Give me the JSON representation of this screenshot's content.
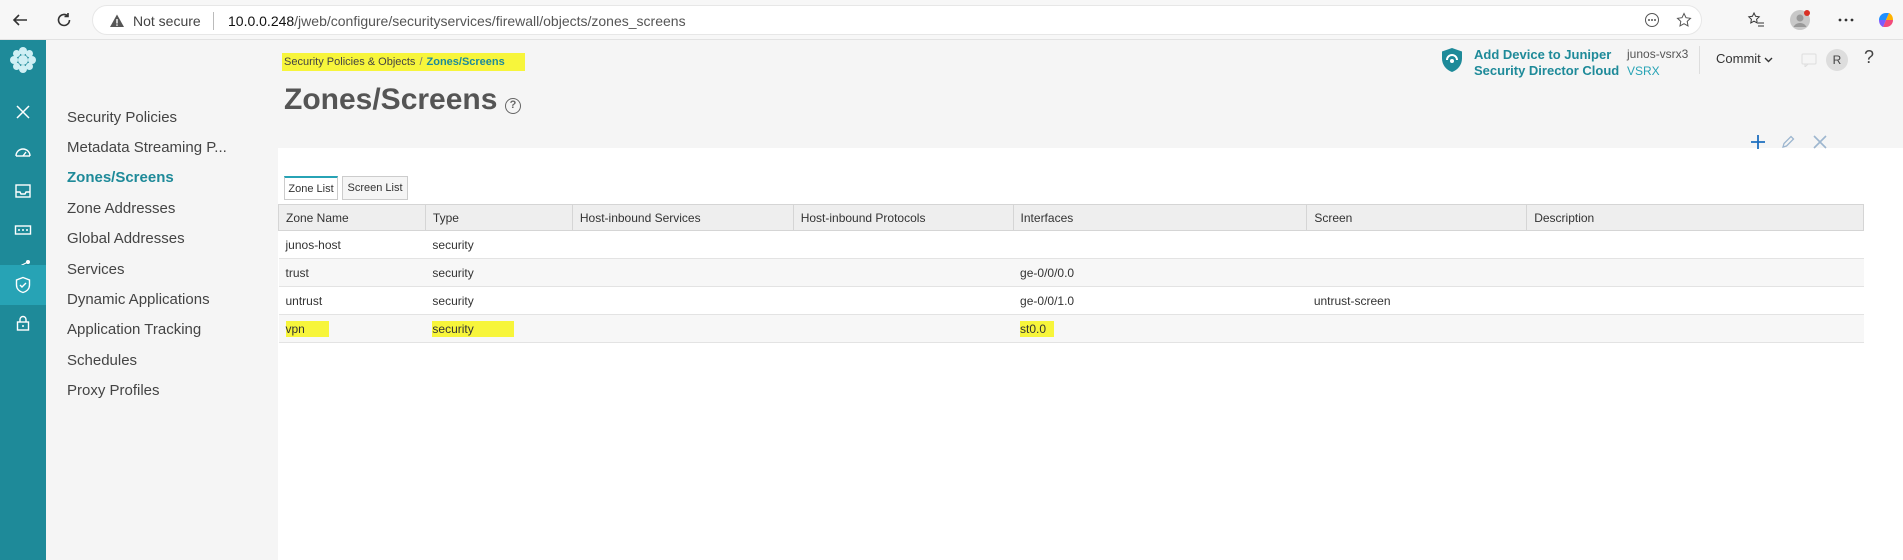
{
  "browser": {
    "not_secure": "Not secure",
    "url_host": "10.0.0.248",
    "url_path": "/jweb/configure/securityservices/firewall/objects/zones_screens"
  },
  "sidenav": {
    "items": [
      {
        "label": "Security Policies"
      },
      {
        "label": "Metadata Streaming P..."
      },
      {
        "label": "Zones/Screens"
      },
      {
        "label": "Zone Addresses"
      },
      {
        "label": "Global Addresses"
      },
      {
        "label": "Services"
      },
      {
        "label": "Dynamic Applications"
      },
      {
        "label": "Application Tracking"
      },
      {
        "label": "Schedules"
      },
      {
        "label": "Proxy Profiles"
      }
    ]
  },
  "breadcrumb": {
    "parent": "Security Policies & Objects",
    "separator": "/",
    "current": "Zones/Screens"
  },
  "page": {
    "title": "Zones/Screens",
    "help": "?"
  },
  "header": {
    "sd_line1": "Add Device to Juniper",
    "sd_line2": "Security Director Cloud",
    "device_name": "junos-vsrx3",
    "device_type": "VSRX",
    "commit": "Commit",
    "avatar": "R",
    "help": "?"
  },
  "tabs": [
    {
      "label": "Zone List"
    },
    {
      "label": "Screen List"
    }
  ],
  "table": {
    "columns": [
      "Zone Name",
      "Type",
      "Host-inbound Services",
      "Host-inbound Protocols",
      "Interfaces",
      "Screen",
      "Description"
    ],
    "rows": [
      [
        "junos-host",
        "security",
        "",
        "",
        "",
        "",
        ""
      ],
      [
        "trust",
        "security",
        "",
        "",
        "ge-0/0/0.0",
        "",
        ""
      ],
      [
        "untrust",
        "security",
        "",
        "",
        "ge-0/0/1.0",
        "untrust-screen",
        ""
      ],
      [
        "vpn",
        "security",
        "",
        "",
        "st0.0",
        "",
        ""
      ]
    ]
  },
  "colors": {
    "rail": "#1e8a99",
    "accent": "#1e8a99",
    "highlight": "#f7f53b"
  }
}
